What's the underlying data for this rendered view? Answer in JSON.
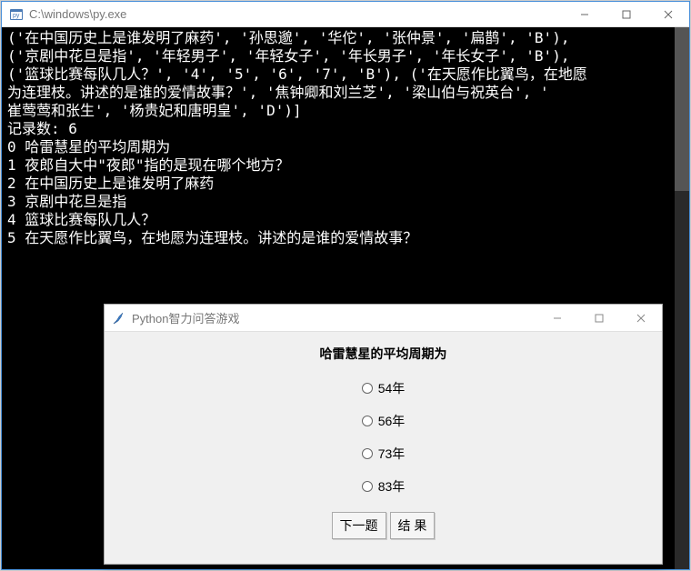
{
  "console": {
    "title": "C:\\windows\\py.exe",
    "content": "('在中国历史上是谁发明了麻药', '孙思邈', '华佗', '张仲景', '扁鹊', 'B'),\n('京剧中花旦是指', '年轻男子', '年轻女子', '年长男子', '年长女子', 'B'),\n('篮球比赛每队几人？', '4', '5', '6', '7', 'B'), ('在天愿作比翼鸟，在地愿\n为连理枝。讲述的是谁的爱情故事？', '焦钟卿和刘兰芝', '梁山伯与祝英台', '\n崔莺莺和张生', '杨贵妃和唐明皇', 'D')]\n记录数: 6\n0 哈雷慧星的平均周期为\n1 夜郎自大中\"夜郎\"指的是现在哪个地方？\n2 在中国历史上是谁发明了麻药\n3 京剧中花旦是指\n4 篮球比赛每队几人？\n5 在天愿作比翼鸟，在地愿为连理枝。讲述的是谁的爱情故事？"
  },
  "quiz": {
    "title": "Python智力问答游戏",
    "question": "哈雷慧星的平均周期为",
    "options": [
      "54年",
      "56年",
      "73年",
      "83年"
    ],
    "buttons": {
      "next": "下一题",
      "result": "结 果"
    }
  }
}
